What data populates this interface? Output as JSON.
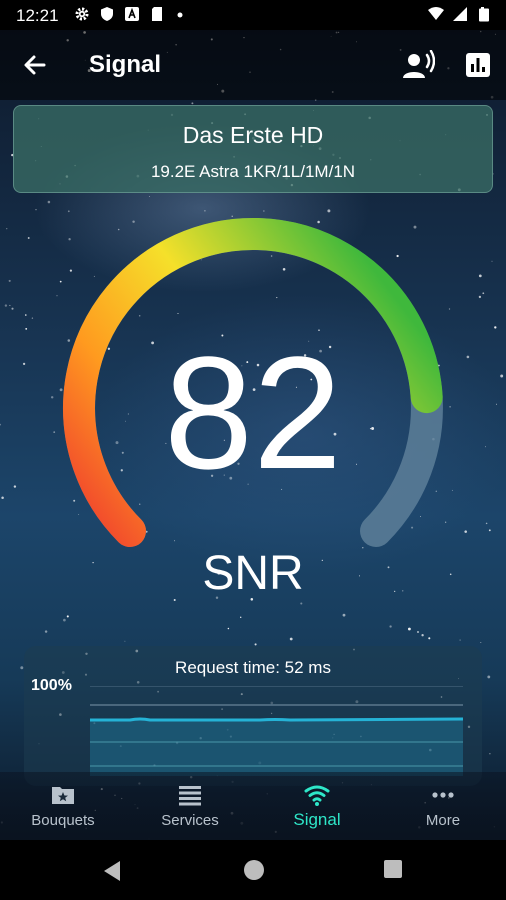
{
  "status_bar": {
    "time": "12:21"
  },
  "app_bar": {
    "title": "Signal"
  },
  "channel": {
    "name": "Das Erste HD",
    "satellite": "19.2E Astra 1KR/1L/1M/1N"
  },
  "gauge": {
    "value": "82",
    "label": "SNR",
    "level": 0.82
  },
  "request": {
    "text": "Request time: 52 ms",
    "max_label": "100%"
  },
  "nav": {
    "items": [
      {
        "label": "Bouquets",
        "icon": "folder-star-icon"
      },
      {
        "label": "Services",
        "icon": "list-icon"
      },
      {
        "label": "Signal",
        "icon": "wifi-signal-icon"
      },
      {
        "label": "More",
        "icon": "more-dots-icon"
      }
    ],
    "active": "Signal"
  },
  "colors": {
    "accent": "#2ee6c8",
    "card": "#386c64",
    "gauge_track": "#5d7f99",
    "chart_line": "#25b3d6"
  }
}
